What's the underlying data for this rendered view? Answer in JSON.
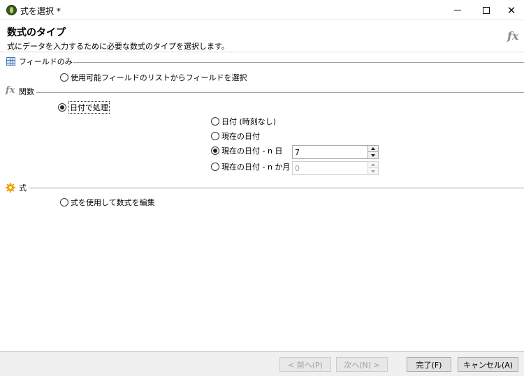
{
  "window": {
    "title": "式を選択 *",
    "icon": "app-icon",
    "controls": {
      "minimize": "minimize",
      "maximize": "maximize",
      "close": "✕"
    }
  },
  "header": {
    "title": "数式のタイプ",
    "subtitle": "式にデータを入力するために必要な数式のタイプを選択します。",
    "logo": "fx"
  },
  "sections": {
    "fields": {
      "label": "フィールドのみ",
      "icon": "grid-icon",
      "option": {
        "label": "使用可能フィールドのリストからフィールドを選択",
        "checked": false
      }
    },
    "functions": {
      "label": "関数",
      "icon": "fx-icon",
      "icon_text": "fx",
      "option": {
        "label": "日付で処理",
        "checked": true
      },
      "sub_options": [
        {
          "label": "日付 (時刻なし)",
          "checked": false
        },
        {
          "label": "現在の日付",
          "checked": false
        },
        {
          "label": "現在の日付 - n 日",
          "checked": true,
          "spin_value": "7",
          "spin_enabled": true
        },
        {
          "label": "現在の日付 - n か月",
          "checked": false,
          "spin_value": "0",
          "spin_enabled": false
        }
      ]
    },
    "expression": {
      "label": "式",
      "icon": "gear-icon",
      "option": {
        "label": "式を使用して数式を編集",
        "checked": false
      }
    }
  },
  "footer": {
    "back": "< 前へ(P)",
    "next": "次へ(N) >",
    "finish": "完了(F)",
    "cancel": "キャンセル(A)"
  },
  "colors": {
    "accent": "#4b77b3",
    "gear": "#f0a30a",
    "fx": "#8a8a8a"
  }
}
